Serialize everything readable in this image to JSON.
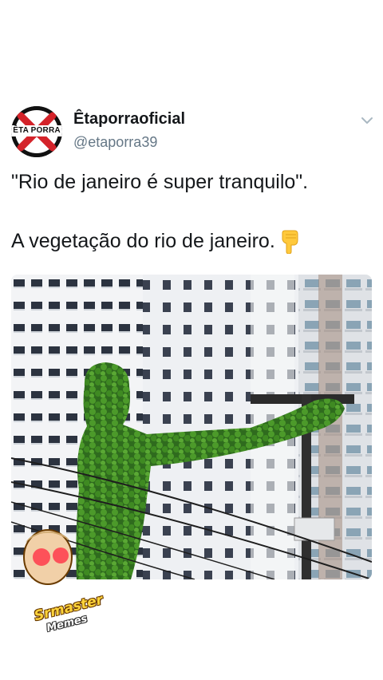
{
  "tweet": {
    "display_name": "Êtaporraoficial",
    "handle": "@etaporra39",
    "avatar_text": "ÊTA PORRA",
    "text_line1": "\"Rio de janeiro é super tranquilo\".",
    "text_line2": "A vegetação do rio de janeiro.",
    "emoji": "pointing-down-hand-icon"
  },
  "watermark": {
    "line1": "Srmaster",
    "line2": "Memes"
  },
  "colors": {
    "text": "#14171a",
    "secondary": "#657786",
    "avatar_red": "#d4232a"
  }
}
